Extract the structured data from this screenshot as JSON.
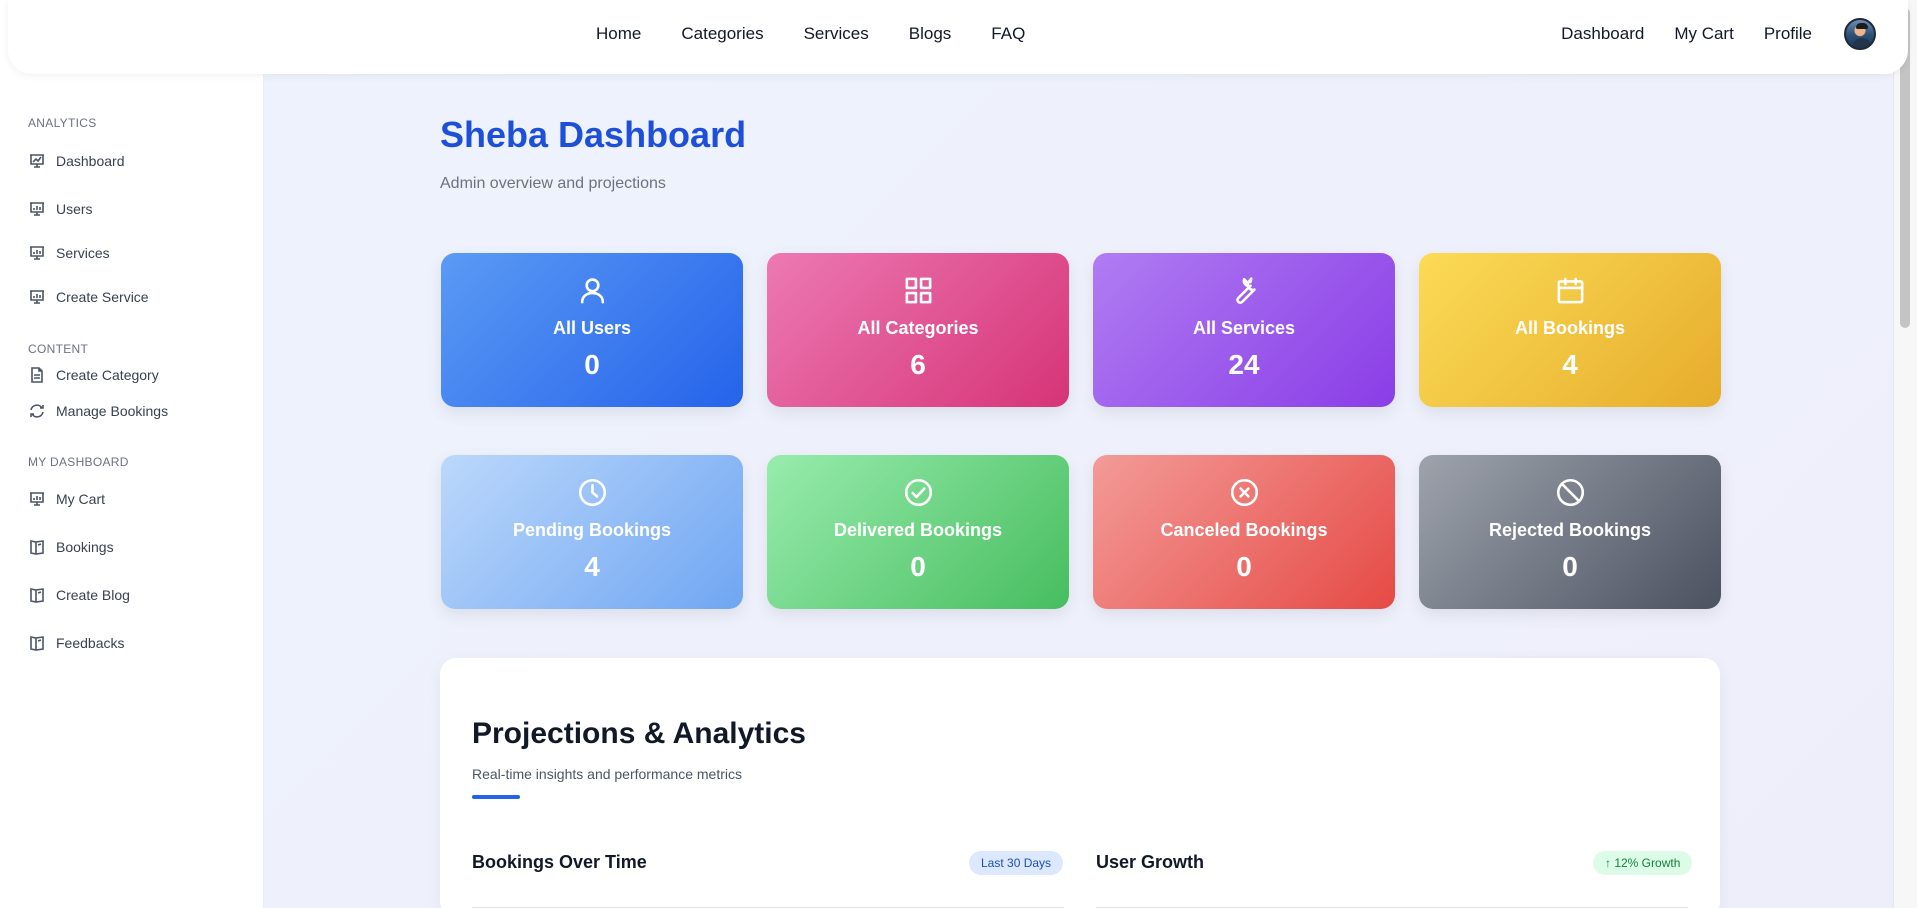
{
  "nav": {
    "links": [
      "Home",
      "Categories",
      "Services",
      "Blogs",
      "FAQ"
    ],
    "right_links": [
      "Dashboard",
      "My Cart",
      "Profile"
    ]
  },
  "sidebar": {
    "sections": [
      {
        "title": "ANALYTICS",
        "items": [
          {
            "label": "Dashboard",
            "icon": "presentation-chart-icon"
          },
          {
            "label": "Users",
            "icon": "presentation-chart-icon"
          },
          {
            "label": "Services",
            "icon": "presentation-chart-icon"
          },
          {
            "label": "Create Service",
            "icon": "presentation-chart-icon"
          }
        ]
      },
      {
        "title": "CONTENT",
        "items": [
          {
            "label": "Create Category",
            "icon": "document-icon"
          },
          {
            "label": "Manage Bookings",
            "icon": "refresh-icon"
          }
        ]
      },
      {
        "title": "MY DASHBOARD",
        "items": [
          {
            "label": "My Cart",
            "icon": "presentation-chart-icon"
          },
          {
            "label": "Bookings",
            "icon": "book-icon"
          },
          {
            "label": "Create Blog",
            "icon": "book-icon"
          },
          {
            "label": "Feedbacks",
            "icon": "book-icon"
          }
        ]
      }
    ]
  },
  "main": {
    "title": "Sheba Dashboard",
    "subtitle": "Admin overview and projections"
  },
  "stats": [
    {
      "label": "All Users",
      "value": "0",
      "icon": "user-icon"
    },
    {
      "label": "All Categories",
      "value": "6",
      "icon": "grid-icon"
    },
    {
      "label": "All Services",
      "value": "24",
      "icon": "wrench-icon"
    },
    {
      "label": "All Bookings",
      "value": "4",
      "icon": "calendar-icon"
    },
    {
      "label": "Pending Bookings",
      "value": "4",
      "icon": "clock-icon"
    },
    {
      "label": "Delivered Bookings",
      "value": "0",
      "icon": "check-circle-icon"
    },
    {
      "label": "Canceled Bookings",
      "value": "0",
      "icon": "x-circle-icon"
    },
    {
      "label": "Rejected Bookings",
      "value": "0",
      "icon": "ban-icon"
    }
  ],
  "analytics": {
    "title": "Projections & Analytics",
    "subtitle": "Real-time insights and performance metrics",
    "bookings_title": "Bookings Over Time",
    "bookings_badge": "Last 30 Days",
    "growth_title": "User Growth",
    "growth_badge": "↑ 12% Growth"
  },
  "colors": {
    "brand": "#1d4fd8",
    "accent_underline": "#2563eb"
  }
}
